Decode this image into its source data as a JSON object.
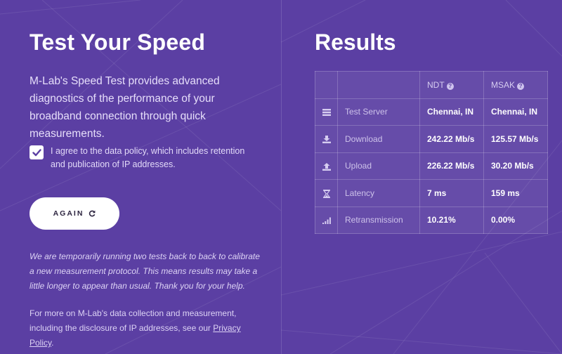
{
  "left": {
    "title": "Test Your Speed",
    "intro": "M-Lab's Speed Test provides advanced diagnostics of the performance of your broadband connection through quick measurements.",
    "agree_checked": true,
    "agree_text": "I agree to the data policy, which includes retention and publication of IP addresses.",
    "again_button": "AGAIN",
    "notice": "We are temporarily running two tests back to back to calibrate a new measurement protocol. This means results may take a little longer to appear than usual. Thank you for your help.",
    "more_prefix": "For more on M-Lab's data collection and measurement, including the disclosure of IP addresses, see our ",
    "privacy_link": "Privacy Policy",
    "more_suffix": "."
  },
  "right": {
    "title": "Results",
    "columns": {
      "ndt": "NDT",
      "msak": "MSAK"
    },
    "rows": [
      {
        "icon": "server-icon",
        "metric": "Test Server",
        "ndt": "Chennai, IN",
        "msak": "Chennai, IN"
      },
      {
        "icon": "download-icon",
        "metric": "Download",
        "ndt": "242.22 Mb/s",
        "msak": "125.57 Mb/s"
      },
      {
        "icon": "upload-icon",
        "metric": "Upload",
        "ndt": "226.22 Mb/s",
        "msak": "30.20 Mb/s"
      },
      {
        "icon": "hourglass-icon",
        "metric": "Latency",
        "ndt": "7 ms",
        "msak": "159 ms"
      },
      {
        "icon": "signal-icon",
        "metric": "Retransmission",
        "ndt": "10.21%",
        "msak": "0.00%"
      }
    ]
  },
  "colors": {
    "background": "#5b3fa3",
    "checkbox_check": "#5b3fa3",
    "button_bg": "#ffffff",
    "button_text": "#2d2540"
  }
}
